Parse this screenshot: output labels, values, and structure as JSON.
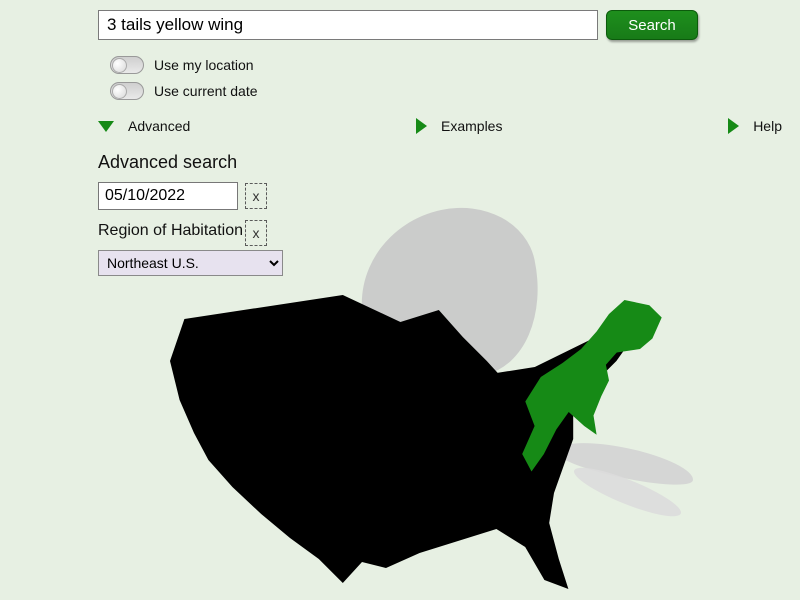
{
  "search": {
    "value": "3 tails yellow wing",
    "button_label": "Search"
  },
  "toggles": {
    "use_location_label": "Use my location",
    "use_date_label": "Use current date"
  },
  "links": {
    "advanced": "Advanced",
    "examples": "Examples",
    "help": "Help"
  },
  "advanced": {
    "title": "Advanced search",
    "date_value": "05/10/2022",
    "clear_symbol": "x",
    "region_label": "Region of Habitation",
    "region_selected": "Northeast U.S.",
    "region_options": [
      "Northeast U.S."
    ]
  },
  "colors": {
    "accent_green": "#168a16",
    "background": "#e7f0e3"
  }
}
